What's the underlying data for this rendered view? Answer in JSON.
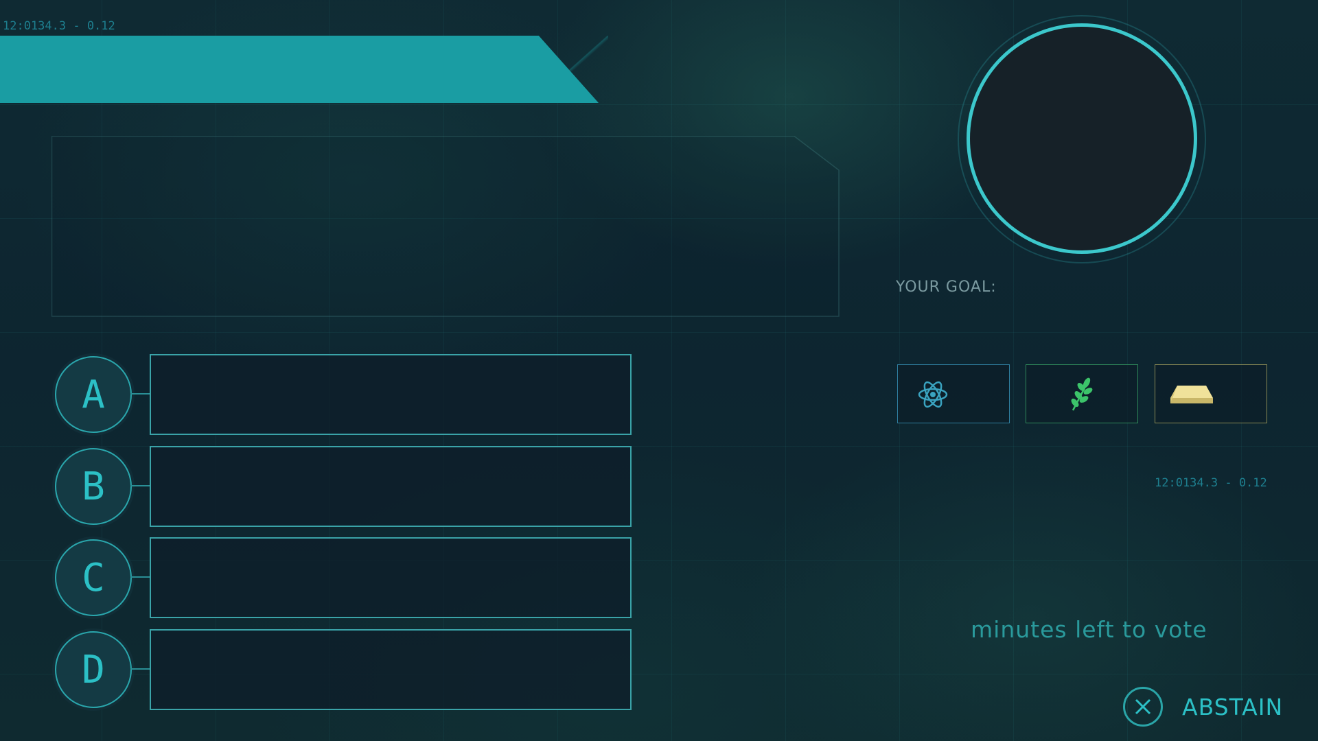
{
  "header": {
    "code": "12:0134.3 - 0.12"
  },
  "goal": {
    "label": "YOUR GOAL:",
    "tiles": [
      {
        "icon": "atom-icon",
        "color": "#3aa3c0"
      },
      {
        "icon": "wheat-icon",
        "color": "#3cc46a"
      },
      {
        "icon": "gold-bar-icon",
        "color": "#e8d88a"
      }
    ],
    "code": "12:0134.3 - 0.12"
  },
  "options": [
    {
      "letter": "A"
    },
    {
      "letter": "B"
    },
    {
      "letter": "C"
    },
    {
      "letter": "D"
    }
  ],
  "timer": {
    "label": "minutes left to vote"
  },
  "abstain": {
    "label": "ABSTAIN",
    "icon": "close-icon"
  },
  "colors": {
    "accent": "#1a9da3",
    "ring": "#3cc8cc"
  }
}
